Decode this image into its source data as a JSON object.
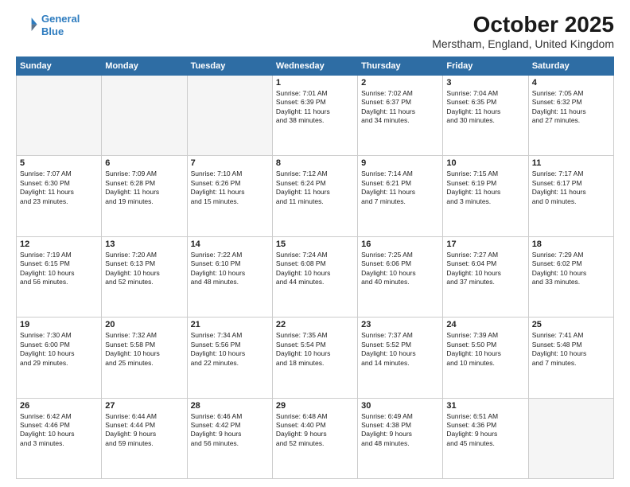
{
  "header": {
    "logo_line1": "General",
    "logo_line2": "Blue",
    "month": "October 2025",
    "location": "Merstham, England, United Kingdom"
  },
  "weekdays": [
    "Sunday",
    "Monday",
    "Tuesday",
    "Wednesday",
    "Thursday",
    "Friday",
    "Saturday"
  ],
  "weeks": [
    [
      {
        "day": "",
        "info": ""
      },
      {
        "day": "",
        "info": ""
      },
      {
        "day": "",
        "info": ""
      },
      {
        "day": "1",
        "info": "Sunrise: 7:01 AM\nSunset: 6:39 PM\nDaylight: 11 hours\nand 38 minutes."
      },
      {
        "day": "2",
        "info": "Sunrise: 7:02 AM\nSunset: 6:37 PM\nDaylight: 11 hours\nand 34 minutes."
      },
      {
        "day": "3",
        "info": "Sunrise: 7:04 AM\nSunset: 6:35 PM\nDaylight: 11 hours\nand 30 minutes."
      },
      {
        "day": "4",
        "info": "Sunrise: 7:05 AM\nSunset: 6:32 PM\nDaylight: 11 hours\nand 27 minutes."
      }
    ],
    [
      {
        "day": "5",
        "info": "Sunrise: 7:07 AM\nSunset: 6:30 PM\nDaylight: 11 hours\nand 23 minutes."
      },
      {
        "day": "6",
        "info": "Sunrise: 7:09 AM\nSunset: 6:28 PM\nDaylight: 11 hours\nand 19 minutes."
      },
      {
        "day": "7",
        "info": "Sunrise: 7:10 AM\nSunset: 6:26 PM\nDaylight: 11 hours\nand 15 minutes."
      },
      {
        "day": "8",
        "info": "Sunrise: 7:12 AM\nSunset: 6:24 PM\nDaylight: 11 hours\nand 11 minutes."
      },
      {
        "day": "9",
        "info": "Sunrise: 7:14 AM\nSunset: 6:21 PM\nDaylight: 11 hours\nand 7 minutes."
      },
      {
        "day": "10",
        "info": "Sunrise: 7:15 AM\nSunset: 6:19 PM\nDaylight: 11 hours\nand 3 minutes."
      },
      {
        "day": "11",
        "info": "Sunrise: 7:17 AM\nSunset: 6:17 PM\nDaylight: 11 hours\nand 0 minutes."
      }
    ],
    [
      {
        "day": "12",
        "info": "Sunrise: 7:19 AM\nSunset: 6:15 PM\nDaylight: 10 hours\nand 56 minutes."
      },
      {
        "day": "13",
        "info": "Sunrise: 7:20 AM\nSunset: 6:13 PM\nDaylight: 10 hours\nand 52 minutes."
      },
      {
        "day": "14",
        "info": "Sunrise: 7:22 AM\nSunset: 6:10 PM\nDaylight: 10 hours\nand 48 minutes."
      },
      {
        "day": "15",
        "info": "Sunrise: 7:24 AM\nSunset: 6:08 PM\nDaylight: 10 hours\nand 44 minutes."
      },
      {
        "day": "16",
        "info": "Sunrise: 7:25 AM\nSunset: 6:06 PM\nDaylight: 10 hours\nand 40 minutes."
      },
      {
        "day": "17",
        "info": "Sunrise: 7:27 AM\nSunset: 6:04 PM\nDaylight: 10 hours\nand 37 minutes."
      },
      {
        "day": "18",
        "info": "Sunrise: 7:29 AM\nSunset: 6:02 PM\nDaylight: 10 hours\nand 33 minutes."
      }
    ],
    [
      {
        "day": "19",
        "info": "Sunrise: 7:30 AM\nSunset: 6:00 PM\nDaylight: 10 hours\nand 29 minutes."
      },
      {
        "day": "20",
        "info": "Sunrise: 7:32 AM\nSunset: 5:58 PM\nDaylight: 10 hours\nand 25 minutes."
      },
      {
        "day": "21",
        "info": "Sunrise: 7:34 AM\nSunset: 5:56 PM\nDaylight: 10 hours\nand 22 minutes."
      },
      {
        "day": "22",
        "info": "Sunrise: 7:35 AM\nSunset: 5:54 PM\nDaylight: 10 hours\nand 18 minutes."
      },
      {
        "day": "23",
        "info": "Sunrise: 7:37 AM\nSunset: 5:52 PM\nDaylight: 10 hours\nand 14 minutes."
      },
      {
        "day": "24",
        "info": "Sunrise: 7:39 AM\nSunset: 5:50 PM\nDaylight: 10 hours\nand 10 minutes."
      },
      {
        "day": "25",
        "info": "Sunrise: 7:41 AM\nSunset: 5:48 PM\nDaylight: 10 hours\nand 7 minutes."
      }
    ],
    [
      {
        "day": "26",
        "info": "Sunrise: 6:42 AM\nSunset: 4:46 PM\nDaylight: 10 hours\nand 3 minutes."
      },
      {
        "day": "27",
        "info": "Sunrise: 6:44 AM\nSunset: 4:44 PM\nDaylight: 9 hours\nand 59 minutes."
      },
      {
        "day": "28",
        "info": "Sunrise: 6:46 AM\nSunset: 4:42 PM\nDaylight: 9 hours\nand 56 minutes."
      },
      {
        "day": "29",
        "info": "Sunrise: 6:48 AM\nSunset: 4:40 PM\nDaylight: 9 hours\nand 52 minutes."
      },
      {
        "day": "30",
        "info": "Sunrise: 6:49 AM\nSunset: 4:38 PM\nDaylight: 9 hours\nand 48 minutes."
      },
      {
        "day": "31",
        "info": "Sunrise: 6:51 AM\nSunset: 4:36 PM\nDaylight: 9 hours\nand 45 minutes."
      },
      {
        "day": "",
        "info": ""
      }
    ]
  ]
}
